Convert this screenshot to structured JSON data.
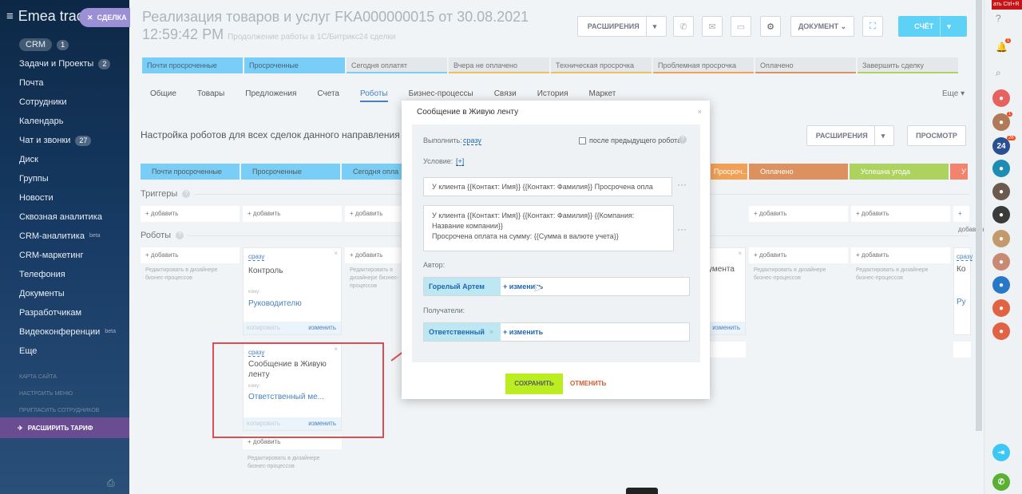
{
  "sidebar": {
    "logo": "Emea trac",
    "items": [
      {
        "label": "CRM",
        "count": "1"
      },
      {
        "label": "Задачи и Проекты",
        "count": "2"
      },
      {
        "label": "Почта"
      },
      {
        "label": "Сотрудники"
      },
      {
        "label": "Календарь"
      },
      {
        "label": "Чат и звонки",
        "count": "27"
      },
      {
        "label": "Диск"
      },
      {
        "label": "Группы"
      },
      {
        "label": "Новости"
      },
      {
        "label": "Сквозная аналитика"
      },
      {
        "label": "CRM-аналитика",
        "sup": "beta"
      },
      {
        "label": "CRM-маркетинг"
      },
      {
        "label": "Телефония"
      },
      {
        "label": "Документы"
      },
      {
        "label": "Разработчикам"
      },
      {
        "label": "Видеоконференции",
        "sup": "beta"
      },
      {
        "label": "Еще"
      }
    ],
    "dim_items": [
      "КАРТА САЙТА",
      "НАСТРОИТЬ МЕНЮ",
      "ПРИГЛАСИТЬ СОТРУДНИКОВ"
    ],
    "upgrade": "РАСШИРИТЬ ТАРИФ"
  },
  "deal_tag": "СДЕЛКА",
  "header": {
    "title": "Реализация товаров и услуг FKA000000015 от 30.08.2021 12:59:42 PM",
    "subtitle": "Продолжение работы в 1С/Битрикс24 сделки",
    "extensions_btn": "РАСШИРЕНИЯ",
    "document_btn": "ДОКУМЕНТ",
    "invoice_btn": "СЧЁТ"
  },
  "stage_bar": [
    {
      "label": "Почти просроченные",
      "color": "#5bc4f5",
      "active": true
    },
    {
      "label": "Просроченные",
      "color": "#5bc4f5",
      "active": true
    },
    {
      "label": "Сегодня оплатят",
      "color": "#5bc4f5"
    },
    {
      "label": "Вчера не оплачено",
      "color": "#e8b339"
    },
    {
      "label": "Техническая просрочка",
      "color": "#e8b339"
    },
    {
      "label": "Проблемная просрочка",
      "color": "#f08b30"
    },
    {
      "label": "Оплачено",
      "color": "#d5793b"
    },
    {
      "label": "Завершить сделку",
      "color": "#9cc83a"
    }
  ],
  "tabs": [
    "Общие",
    "Товары",
    "Предложения",
    "Счета",
    "Роботы",
    "Бизнес-процессы",
    "Связи",
    "История",
    "Маркет"
  ],
  "active_tab": "Роботы",
  "more": "Еще",
  "robots_page": {
    "title": "Настройка роботов для всех сделок данного направления",
    "extensions_btn": "РАСШИРЕНИЯ",
    "preview_btn": "ПРОСМОТР",
    "triggers_label": "Триггеры",
    "robots_label": "Роботы",
    "add": "+ добавить",
    "hint": "Редактировать в дизайнере бизнес-процессов",
    "columns": [
      {
        "label": "Почти просроченные",
        "color": "#5bc4f5"
      },
      {
        "label": "Просроченные",
        "color": "#5bc4f5"
      },
      {
        "label": "Сегодня опла",
        "color": "#5bc4f5"
      },
      {
        "label": "Просроч...",
        "color": "#f08b30"
      },
      {
        "label": "Оплачено",
        "color": "#d5793b"
      },
      {
        "label": "Успешна угода",
        "color": "#9cc83a"
      },
      {
        "label": "У",
        "color": "#f06a4f"
      }
    ],
    "card1": {
      "when": "сразу",
      "name": "Контроль",
      "to": "кому:",
      "target": "Руководителю",
      "foot_left": "копировать",
      "foot_right": "изменить"
    },
    "card2": {
      "when": "сразу",
      "name": "Сообщение в Живую ленту",
      "to": "кому:",
      "target": "Ответственный ме...",
      "foot_left": "копировать",
      "foot_right": "изменить"
    },
    "card_right_name": "умента",
    "card_right_foot": "изменить",
    "card_far_name": "Ко",
    "card_far_target": "Ру",
    "card_far_when": "сразу"
  },
  "dialog": {
    "title": "Сообщение в Живую ленту",
    "execute_label": "Выполнить:",
    "execute_value": "сразу",
    "after_prev": "после предыдущего робота",
    "condition_label": "Условие:",
    "condition_value": "[+]",
    "message_title": "У клиента {{Контакт: Имя}} {{Контакт: Фамилия}}  Просрочена опла",
    "message_body_1": "У клиента {{Контакт: Имя}} {{Контакт: Фамилия}} {{Компания:",
    "message_body_2": "Название компании}}",
    "message_body_3": "Просрочена оплата на сумму: {{Сумма в валюте учета}}",
    "author_label": "Автор:",
    "author_value": "Горелый Артем",
    "change": "+ изменить",
    "recipients_label": "Получатели:",
    "recipients_value": "Ответственный",
    "save": "СОХРАНИТЬ",
    "cancel": "ОТМЕНИТЬ"
  },
  "right_panel": {
    "top_label": "ать Ctrl+R",
    "badges": [
      "1",
      "1",
      "26"
    ],
    "avatar_24": "24"
  }
}
